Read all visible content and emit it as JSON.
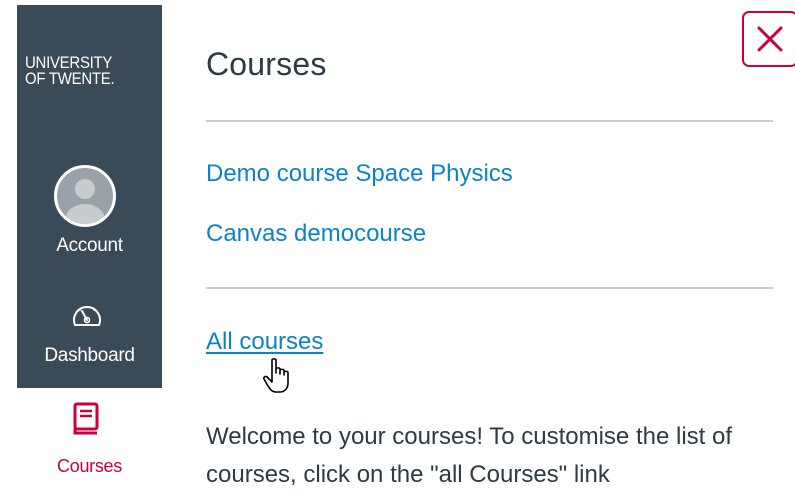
{
  "global_nav": {
    "logo_line1": "UNIVERSITY",
    "logo_line2": "OF TWENTE.",
    "items": [
      {
        "label": "Account",
        "icon": "avatar-icon"
      },
      {
        "label": "Dashboard",
        "icon": "speedometer-icon"
      },
      {
        "label": "Courses",
        "icon": "book-icon",
        "active": true
      }
    ]
  },
  "tray": {
    "title": "Courses",
    "close_icon": "close-icon",
    "courses": [
      "Demo course Space Physics",
      "Canvas democourse"
    ],
    "all_courses_label": "All courses",
    "welcome_text": "Welcome to your courses! To customise the list of courses, click on the \"all Courses\" link"
  },
  "colors": {
    "sidebar_bg": "#394b58",
    "accent": "#c8003c",
    "link": "#0a84c8",
    "text": "#2d3b45",
    "divider": "#c7cdd1"
  }
}
